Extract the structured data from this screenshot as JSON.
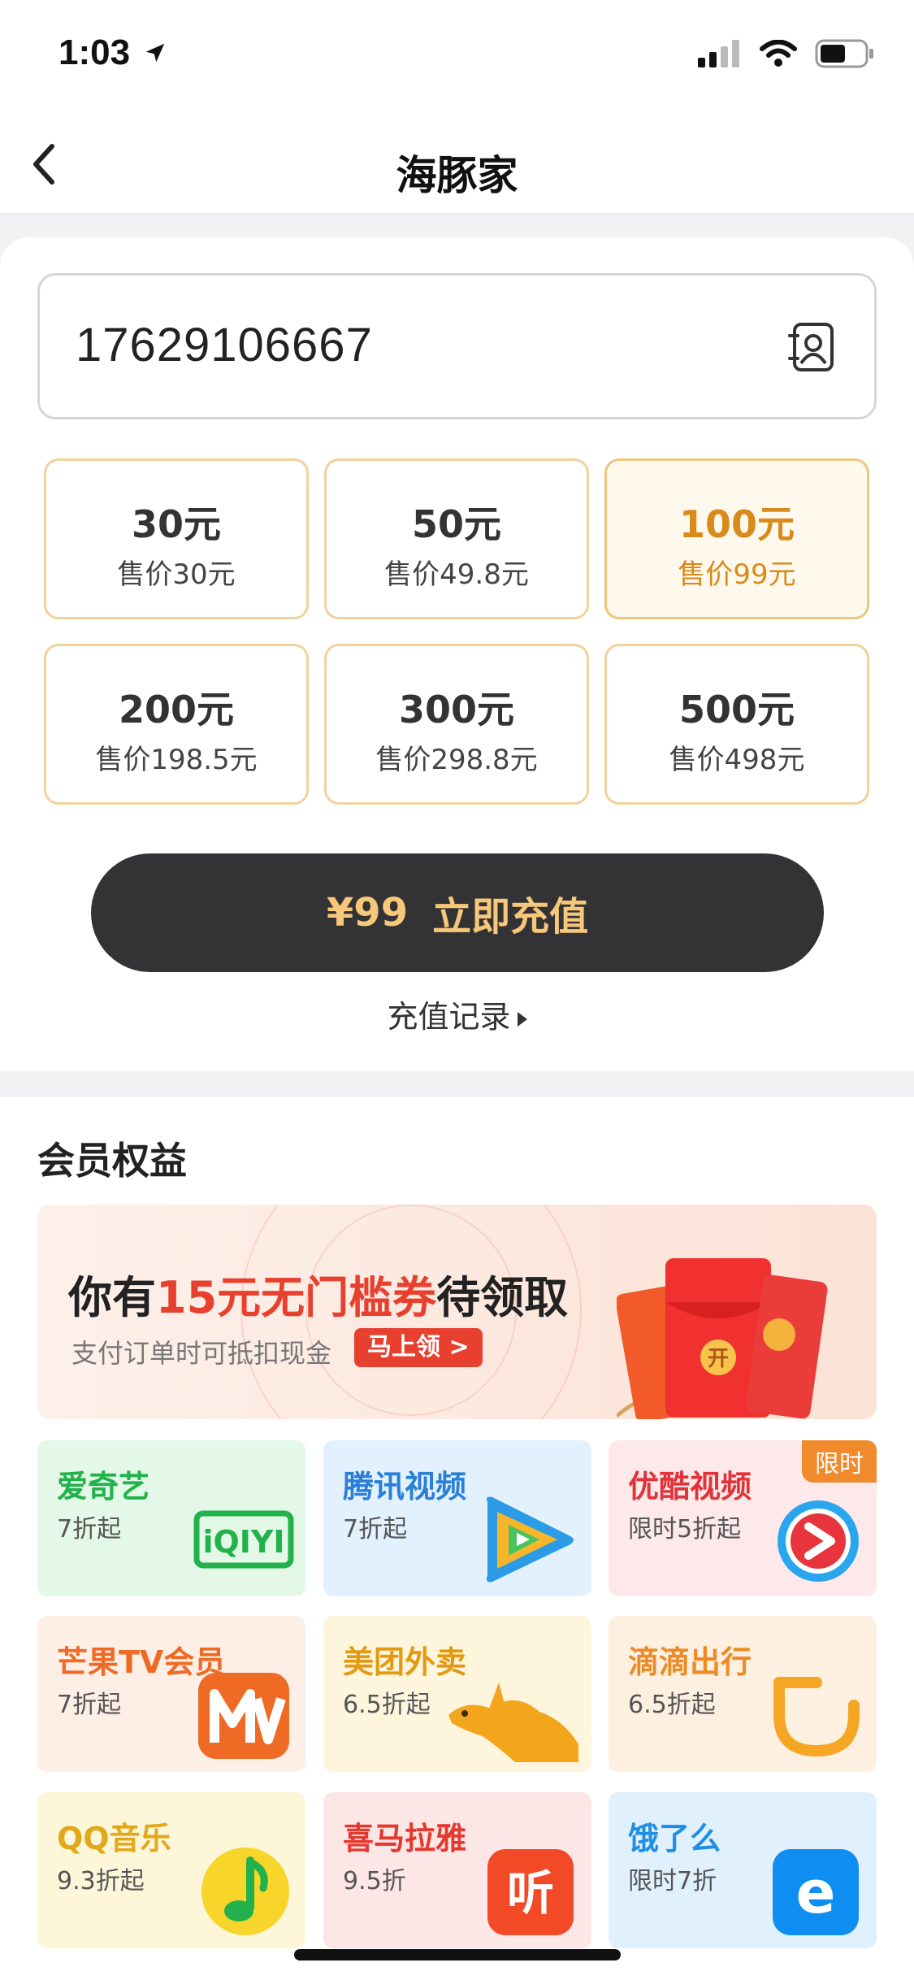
{
  "status_bar": {
    "time": "1:03"
  },
  "nav": {
    "title": "海豚家"
  },
  "recharge": {
    "phone": "17629106667",
    "options": [
      {
        "amount": "30元",
        "price": "售价30元",
        "selected": false
      },
      {
        "amount": "50元",
        "price": "售价49.8元",
        "selected": false
      },
      {
        "amount": "100元",
        "price": "售价99元",
        "selected": true
      },
      {
        "amount": "200元",
        "price": "售价198.5元",
        "selected": false
      },
      {
        "amount": "300元",
        "price": "售价298.8元",
        "selected": false
      },
      {
        "amount": "500元",
        "price": "售价498元",
        "selected": false
      }
    ],
    "pay_price": "¥99",
    "pay_label": "立即充值",
    "record_label": "充值记录"
  },
  "benefits": {
    "title": "会员权益",
    "banner": {
      "text_before": "你有",
      "text_highlight": "15元无门槛券",
      "text_after": "待领取",
      "subtitle": "支付订单时可抵扣现金",
      "cta": "马上领 >",
      "envelope_char": "开"
    },
    "services": [
      {
        "name": "爱奇艺",
        "discount": "7折起",
        "name_color": "#21b24b",
        "bg": "#e4f8e8",
        "icon": "iqiyi-logo",
        "logo_text": "iQIYI"
      },
      {
        "name": "腾讯视频",
        "discount": "7折起",
        "name_color": "#2a7fd6",
        "bg": "#e2f1fd",
        "icon": "tencent-video-logo"
      },
      {
        "name": "优酷视频",
        "discount": "限时5折起",
        "name_color": "#e0343a",
        "bg": "#fde8ea",
        "icon": "youku-logo",
        "badge": "限时"
      },
      {
        "name": "芒果TV会员",
        "discount": "7折起",
        "name_color": "#ef6a25",
        "bg": "#fdeee6",
        "icon": "mango-tv-logo"
      },
      {
        "name": "美团外卖",
        "discount": "6.5折起",
        "name_color": "#e39a12",
        "bg": "#fdf5dc",
        "icon": "meituan-kangaroo-logo"
      },
      {
        "name": "滴滴出行",
        "discount": "6.5折起",
        "name_color": "#ee8a24",
        "bg": "#fdf0e0",
        "icon": "didi-logo"
      },
      {
        "name": "QQ音乐",
        "discount": "9.3折起",
        "name_color": "#e1a81a",
        "bg": "#fdf6d8",
        "icon": "qq-music-logo"
      },
      {
        "name": "喜马拉雅",
        "discount": "9.5折",
        "name_color": "#e5382e",
        "bg": "#fde6e6",
        "icon": "ximalaya-logo",
        "logo_text": "听"
      },
      {
        "name": "饿了么",
        "discount": "限时7折",
        "name_color": "#1f8fe6",
        "bg": "#e0f0fd",
        "icon": "eleme-logo",
        "logo_text": "e"
      }
    ]
  },
  "colors": {
    "accent": "#d88a1a",
    "button_bg": "#333336",
    "button_text": "#f7c77a",
    "tile_border": "#f1d29a"
  }
}
